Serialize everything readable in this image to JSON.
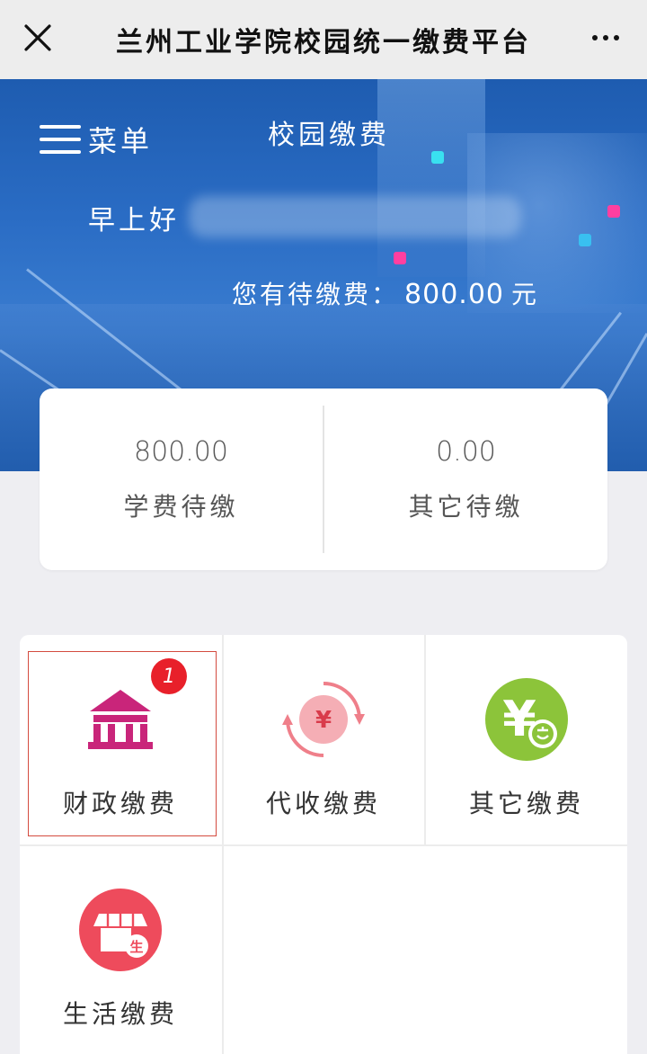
{
  "header": {
    "title": "兰州工业学院校园统一缴费平台"
  },
  "banner": {
    "menu_label": "菜单",
    "title": "校园缴费",
    "greeting": "早上好",
    "pending_label": "您有待缴费：",
    "pending_amount": "800.00",
    "pending_unit": "元"
  },
  "summary": {
    "tuition_amount": "800.00",
    "tuition_label": "学费待缴",
    "other_amount": "0.00",
    "other_label": "其它待缴"
  },
  "services": {
    "items": [
      {
        "label": "财政缴费",
        "icon": "government-building-icon",
        "badge": "1"
      },
      {
        "label": "代收缴费",
        "icon": "yuan-cycle-icon"
      },
      {
        "label": "其它缴费",
        "icon": "yuan-coin-other-icon"
      },
      {
        "label": "生活缴费",
        "icon": "shop-life-icon"
      }
    ]
  },
  "colors": {
    "banner_blue": "#2a6cc4",
    "finance_magenta": "#c9257a",
    "collect_pink": "#ef7f8a",
    "other_green": "#8cc43a",
    "life_red": "#ee4b5c",
    "badge_red": "#e8202a"
  }
}
